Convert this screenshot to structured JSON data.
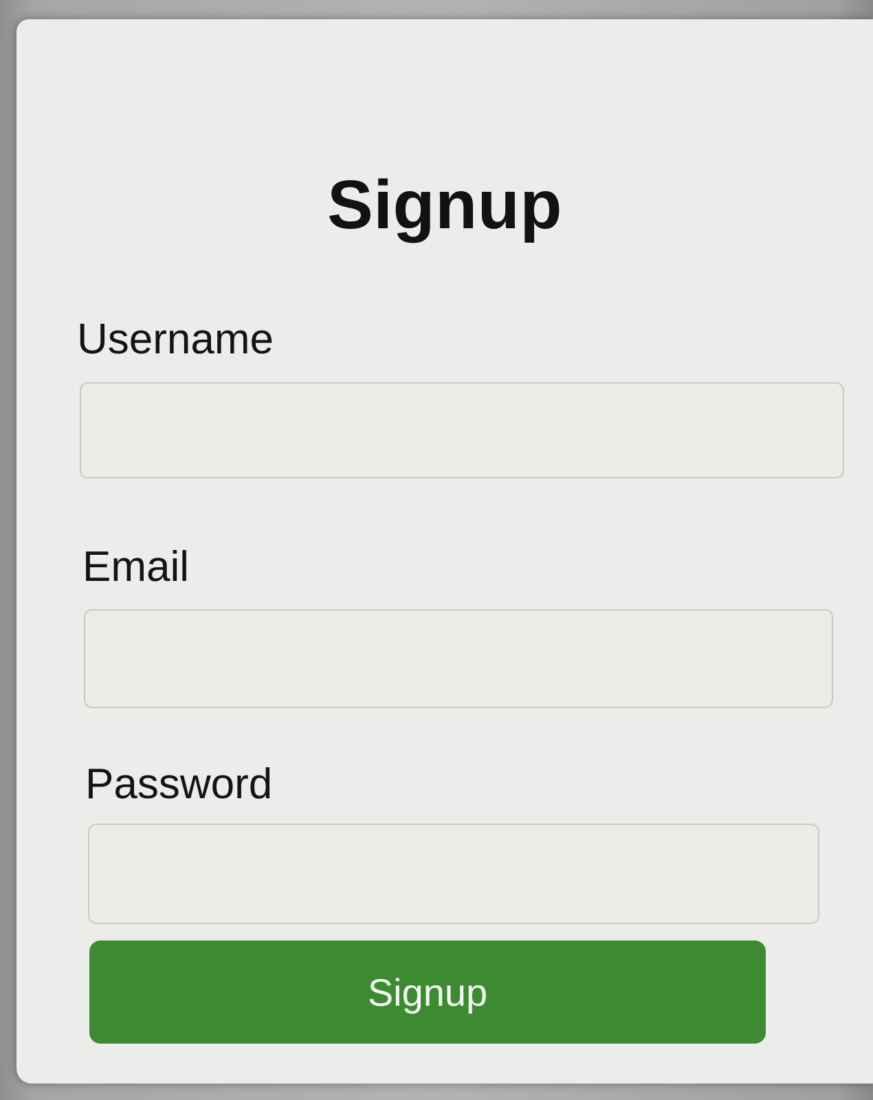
{
  "form": {
    "title": "Signup",
    "fields": [
      {
        "label": "Username",
        "value": "",
        "placeholder": ""
      },
      {
        "label": "Email",
        "value": "",
        "placeholder": ""
      },
      {
        "label": "Password",
        "value": "",
        "placeholder": ""
      }
    ],
    "submit_label": "Signup"
  },
  "colors": {
    "button_bg": "#3c8b31",
    "button_text": "#f4f6f2",
    "card_bg": "#ececea",
    "text": "#141414"
  }
}
